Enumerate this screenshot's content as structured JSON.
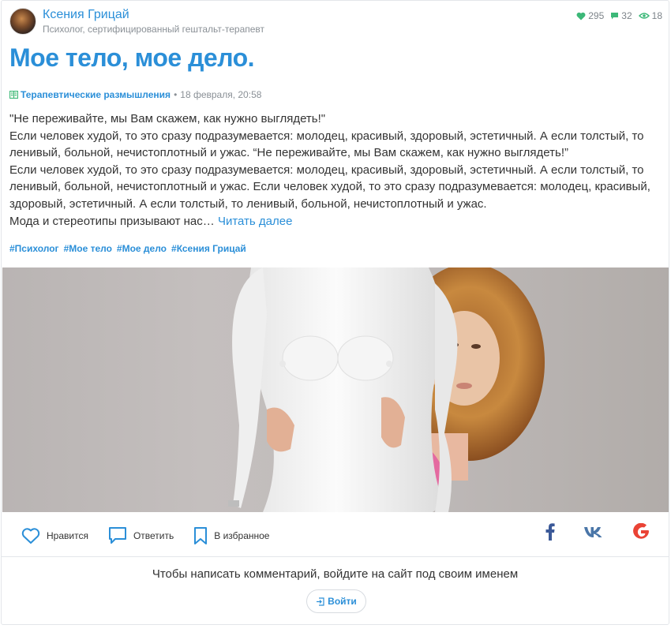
{
  "author": {
    "name": "Ксения Грицай",
    "subtitle": "Психолог, сертифицированный гештальт-терапевт"
  },
  "stats": {
    "likes": "295",
    "comments": "32",
    "views": "18"
  },
  "post": {
    "title": "Мое тело, мое дело.",
    "category": "Терапевтические размышления",
    "separator": "•",
    "date": "18 февраля, 20:58",
    "paragraphs": [
      "\"Не переживайте, мы Вам скажем, как нужно выглядеть!\"",
      "Если человек худой, то это сразу подразумевается: молодец, красивый, здоровый, эстетичный. А если толстый, то ленивый, больной, нечистоплотный и ужас. “Не переживайте, мы Вам скажем, как нужно выглядеть!”",
      "Если человек худой, то это сразу подразумевается: молодец, красивый, здоровый, эстетичный. А если толстый, то ленивый, больной, нечистоплотный и ужас. Если человек худой, то это сразу подразумевается: молодец, красивый, здоровый, эстетичный. А если толстый, то ленивый, больной, нечистоплотный и ужас."
    ],
    "last_line": "Мода и стереотипы призывают нас…",
    "read_more": "Читать далее",
    "tags": [
      "#Психолог",
      "#Мое тело",
      "#Мое дело",
      "#Ксения Грицай"
    ]
  },
  "actions": {
    "like": "Нравится",
    "reply": "Ответить",
    "favorite": "В избранное"
  },
  "comments": {
    "login_prompt": "Чтобы написать комментарий, войдите на сайт под своим именем",
    "login_button": "Войти"
  },
  "colors": {
    "accent": "#2b8fd8",
    "like_green": "#3cb878",
    "facebook": "#3b5998",
    "vk": "#4a76a8",
    "google": "#ea4335"
  }
}
